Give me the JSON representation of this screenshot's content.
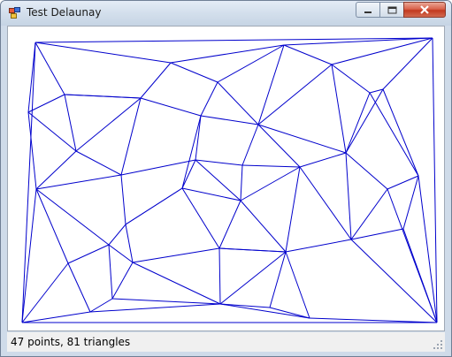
{
  "window": {
    "title": "Test Delaunay",
    "icon": "winforms-app-icon"
  },
  "caption_buttons": {
    "minimize": "minimize-icon",
    "maximize": "maximize-icon",
    "close": "close-icon"
  },
  "canvas": {
    "line_color": "#0000cc",
    "background": "#ffffff"
  },
  "statusbar": {
    "text": "47 points, 81 triangles",
    "grip": "resize-grip-icon"
  }
}
